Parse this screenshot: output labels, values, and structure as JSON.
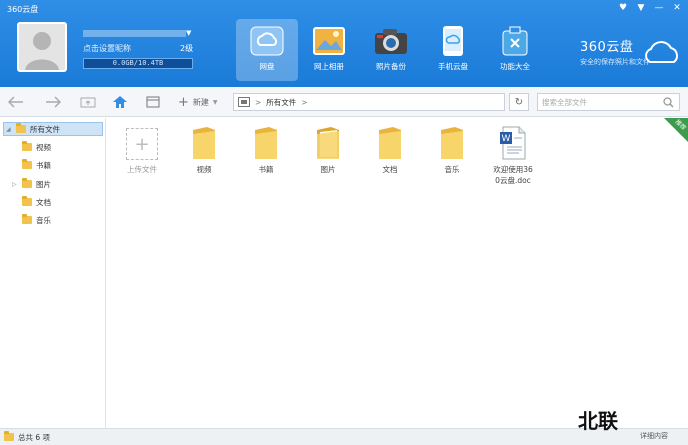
{
  "app": {
    "title": "360云盘"
  },
  "window_controls": [
    "♥",
    "▼",
    "—",
    "✕"
  ],
  "user": {
    "nickname_prompt": "点击设置昵称",
    "level": "2级",
    "storage": "0.0GB/10.4TB"
  },
  "nav": {
    "tabs": [
      {
        "label": "网盘",
        "icon": "cloud-drive-icon",
        "active": true
      },
      {
        "label": "网上相册",
        "icon": "photo-album-icon",
        "active": false
      },
      {
        "label": "照片备份",
        "icon": "camera-icon",
        "active": false
      },
      {
        "label": "手机云盘",
        "icon": "phone-cloud-icon",
        "active": false
      },
      {
        "label": "功能大全",
        "icon": "toolbox-icon",
        "active": false
      }
    ]
  },
  "brand": {
    "name": "360云盘",
    "slogan": "安全的保存照片和文件"
  },
  "toolbar": {
    "new_label": "新建",
    "path_root": "所有文件",
    "search_placeholder": "搜索全部文件"
  },
  "sidebar": {
    "root": "所有文件",
    "items": [
      {
        "label": "视频",
        "has_children": false
      },
      {
        "label": "书籍",
        "has_children": false
      },
      {
        "label": "图片",
        "has_children": true
      },
      {
        "label": "文档",
        "has_children": false
      },
      {
        "label": "音乐",
        "has_children": false
      }
    ]
  },
  "files": {
    "upload_label": "上传文件",
    "items": [
      {
        "label": "视频",
        "type": "folder"
      },
      {
        "label": "书籍",
        "type": "folder"
      },
      {
        "label": "图片",
        "type": "folder"
      },
      {
        "label": "文档",
        "type": "folder"
      },
      {
        "label": "音乐",
        "type": "folder"
      },
      {
        "label": "欢迎使用360云盘.doc",
        "type": "doc"
      }
    ],
    "ribbon": "推荐"
  },
  "status": {
    "summary": "总共 6 项",
    "right": "详细内容"
  },
  "watermark": "北联",
  "colors": {
    "header": "#1a7bd8",
    "folder": "#f2c34c",
    "selection": "#cfe3f7"
  }
}
